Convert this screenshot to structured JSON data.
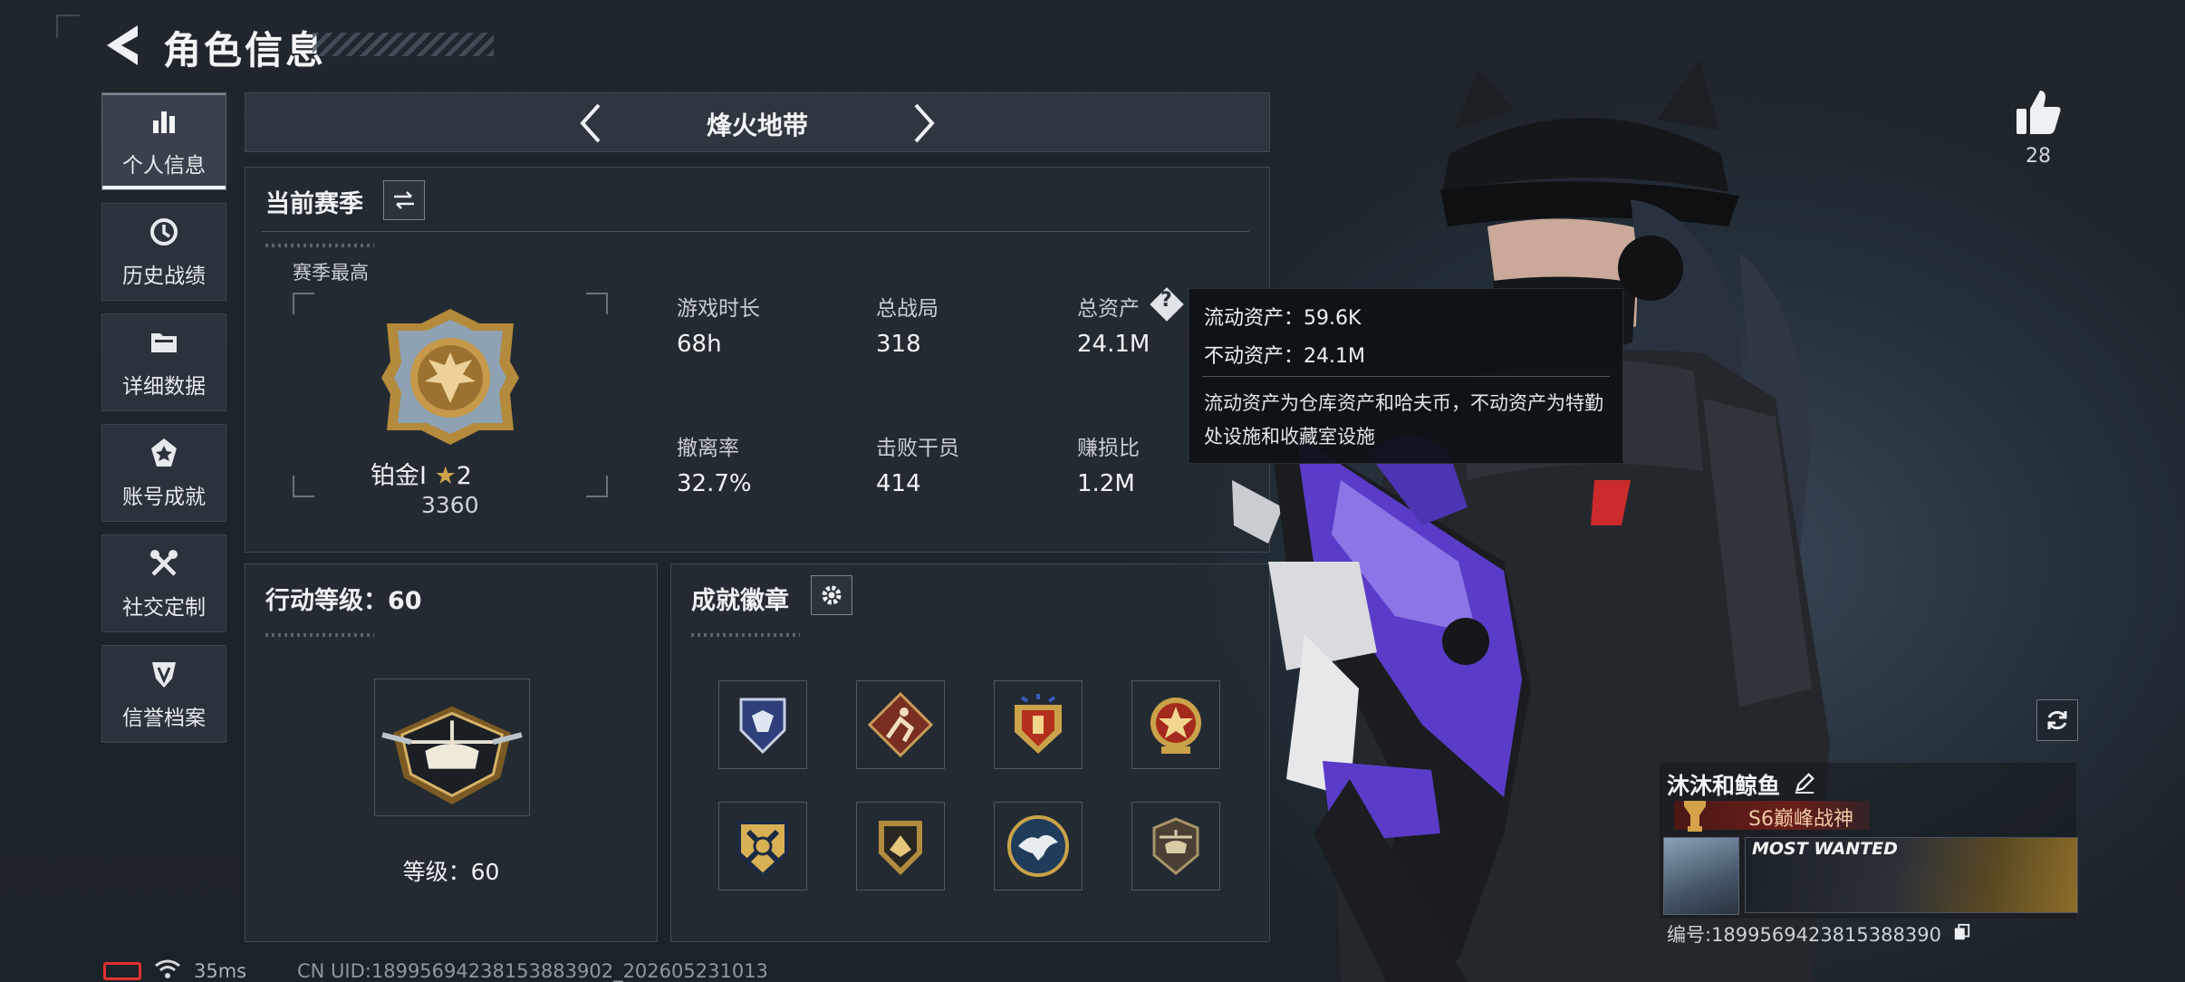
{
  "header": {
    "title": "角色信息"
  },
  "nav": {
    "items": [
      {
        "label": "个人信息",
        "icon": "bar-chart-icon",
        "active": true
      },
      {
        "label": "历史战绩",
        "icon": "history-icon",
        "active": false
      },
      {
        "label": "详细数据",
        "icon": "folder-icon",
        "active": false
      },
      {
        "label": "账号成就",
        "icon": "achievement-icon",
        "active": false
      },
      {
        "label": "社交定制",
        "icon": "tools-icon",
        "active": false
      },
      {
        "label": "信誉档案",
        "icon": "credit-shield-icon",
        "active": false
      }
    ]
  },
  "mode_switcher": {
    "title": "烽火地带"
  },
  "season": {
    "title": "当前赛季",
    "best_label": "赛季最高",
    "rank_name": "铂金Ⅰ",
    "rank_stars": "2",
    "rank_score": "3360",
    "stats": [
      {
        "label": "游戏时长",
        "value": "68h"
      },
      {
        "label": "总战局",
        "value": "318"
      },
      {
        "label": "总资产",
        "value": "24.1M"
      },
      {
        "label": "撤离率",
        "value": "32.7%"
      },
      {
        "label": "击败干员",
        "value": "414"
      },
      {
        "label": "赚损比",
        "value": "1.2M"
      }
    ]
  },
  "tooltip": {
    "line1": "流动资产：59.6K",
    "line2": "不动资产：24.1M",
    "desc": "流动资产为仓库资产和哈夫币，不动资产为特勤处设施和收藏室设施"
  },
  "action_level": {
    "title": "行动等级：60",
    "level_text": "等级：60"
  },
  "badges": {
    "title": "成就徽章",
    "items": [
      "badge-navy-shield",
      "badge-red-runner",
      "badge-gold-red-shield",
      "badge-red-star",
      "badge-gold-crossed",
      "badge-gold-hands",
      "badge-eagle-circle",
      "badge-helicopter"
    ]
  },
  "likes": {
    "count": "28"
  },
  "player": {
    "name": "沐沐和鲸鱼",
    "title": "S6巅峰战神",
    "banner": "MOST WANTED",
    "id": "编号:1899569423815388390"
  },
  "status_bar": {
    "ping": "35ms",
    "uid": "CN UID:1899569423815388390​2_202605231013"
  },
  "colors": {
    "accent": "#ecf1f4",
    "battery_low": "#e33131",
    "title_red": "#6a1f1a",
    "gold": "#c9a24a"
  }
}
